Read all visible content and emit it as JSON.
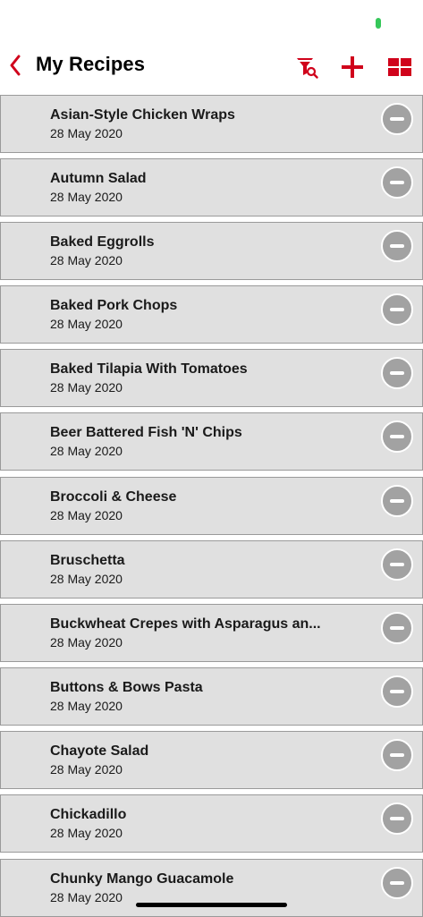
{
  "nav": {
    "title": "My Recipes",
    "back_icon": "chevron-left-icon",
    "filter_icon": "filter-search-icon",
    "add_icon": "plus-icon",
    "grid_icon": "grid-view-icon",
    "accent_color": "#d0021b"
  },
  "status_bar": {
    "battery_color": "#35c759"
  },
  "recipes": [
    {
      "title": "Asian-Style Chicken Wraps",
      "date": "28 May 2020"
    },
    {
      "title": "Autumn Salad",
      "date": "28 May 2020"
    },
    {
      "title": "Baked Eggrolls",
      "date": "28 May 2020"
    },
    {
      "title": "Baked Pork Chops",
      "date": "28 May 2020"
    },
    {
      "title": "Baked Tilapia With Tomatoes",
      "date": "28 May 2020"
    },
    {
      "title": "Beer Battered Fish 'N' Chips",
      "date": "28 May 2020"
    },
    {
      "title": "Broccoli & Cheese",
      "date": "28 May 2020"
    },
    {
      "title": "Bruschetta",
      "date": "28 May 2020"
    },
    {
      "title": "Buckwheat Crepes with Asparagus an...",
      "date": "28 May 2020"
    },
    {
      "title": "Buttons & Bows Pasta",
      "date": "28 May 2020"
    },
    {
      "title": "Chayote Salad",
      "date": "28 May 2020"
    },
    {
      "title": "Chickadillo",
      "date": "28 May 2020"
    },
    {
      "title": "Chunky Mango Guacamole",
      "date": "28 May 2020"
    }
  ]
}
